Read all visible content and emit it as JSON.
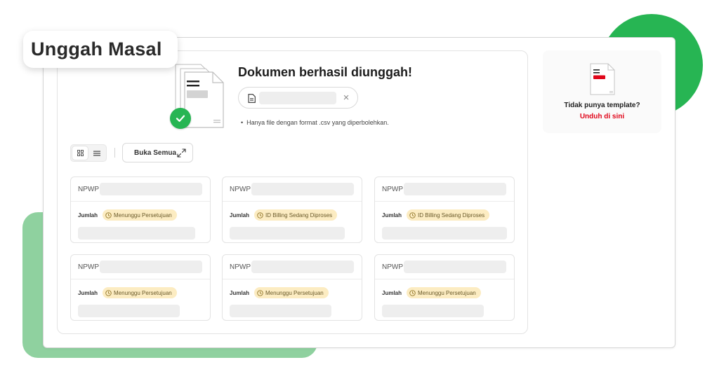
{
  "colors": {
    "brand_green": "#27b553",
    "brand_green_light": "#8fd19f",
    "link_red": "#e0061a",
    "status_badge_bg": "#fcecc2",
    "status_badge_text": "#6a5a2a",
    "placeholder_bar": "#eeeeee"
  },
  "page": {
    "title": "Unggah Masal"
  },
  "upload": {
    "title": "Dokumen berhasil diunggah!",
    "file_icon": "file-icon",
    "remove_icon": "close-icon",
    "remove_symbol": "×",
    "success_icon": "check-circle-icon",
    "note": "Hanya file dengan format .csv yang diperbolehkan.",
    "note_bullet": "•"
  },
  "toolbar": {
    "grid_view_icon": "grid-icon",
    "list_view_icon": "list-icon",
    "open_all_label": "Buka Semua",
    "open_all_icon": "expand-icon"
  },
  "cards": [
    {
      "npwp_label": "NPWP",
      "amount_label": "Jumlah",
      "status": "Menunggu Persetujuan"
    },
    {
      "npwp_label": "NPWP",
      "amount_label": "Jumlah",
      "status": "ID Billing Sedang Diproses"
    },
    {
      "npwp_label": "NPWP",
      "amount_label": "Jumlah",
      "status": "ID Billing Sedang Diproses"
    },
    {
      "npwp_label": "NPWP",
      "amount_label": "Jumlah",
      "status": "Menunggu Persetujuan"
    },
    {
      "npwp_label": "NPWP",
      "amount_label": "Jumlah",
      "status": "Menunggu Persetujuan"
    },
    {
      "npwp_label": "NPWP",
      "amount_label": "Jumlah",
      "status": "Menunggu Persetujuan"
    }
  ],
  "template": {
    "icon": "document-template-icon",
    "question": "Tidak punya template?",
    "download_link": "Unduh di sini"
  }
}
